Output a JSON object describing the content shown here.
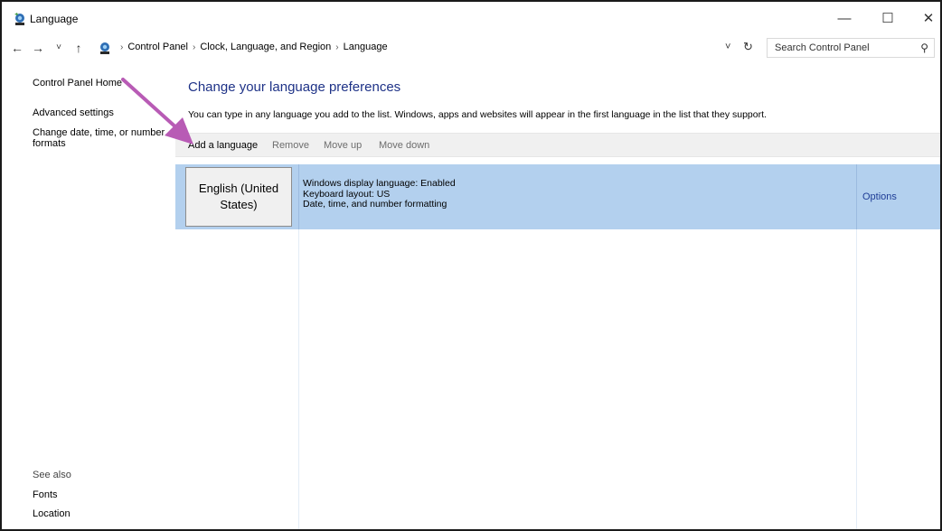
{
  "window": {
    "title": "Language",
    "minimize_glyph": "—",
    "maximize_glyph": "☐",
    "close_glyph": "✕"
  },
  "nav": {
    "back_glyph": "←",
    "forward_glyph": "→",
    "recent_glyph": "˅",
    "up_glyph": "↑",
    "breadcrumbs": [
      "Control Panel",
      "Clock, Language, and Region",
      "Language"
    ],
    "breadcrumb_sep": "›",
    "dropdown_glyph": "˅",
    "refresh_glyph": "↻"
  },
  "search": {
    "placeholder": "Search Control Panel",
    "icon_glyph": "⚲"
  },
  "sidebar": {
    "home": "Control Panel Home",
    "advanced": "Advanced settings",
    "change_formats": "Change date, time, or number formats",
    "see_also": "See also",
    "fonts": "Fonts",
    "location": "Location"
  },
  "main": {
    "title": "Change your language preferences",
    "description": "You can type in any language you add to the list. Windows, apps and websites will appear in the first language in the list that they support.",
    "toolbar": {
      "add": "Add a language",
      "remove": "Remove",
      "move_up": "Move up",
      "move_down": "Move down"
    },
    "languages": [
      {
        "name": "English (United States)",
        "details": [
          "Windows display language: Enabled",
          "Keyboard layout: US",
          "Date, time, and number formatting"
        ],
        "options": "Options"
      }
    ]
  },
  "colors": {
    "title_blue": "#1e3287",
    "selected_row": "#b3d0ee",
    "annotation_arrow": "#b85bb5"
  },
  "icons": {
    "app": "control-panel-icon",
    "annotation": "pointer-arrow-annotation"
  }
}
